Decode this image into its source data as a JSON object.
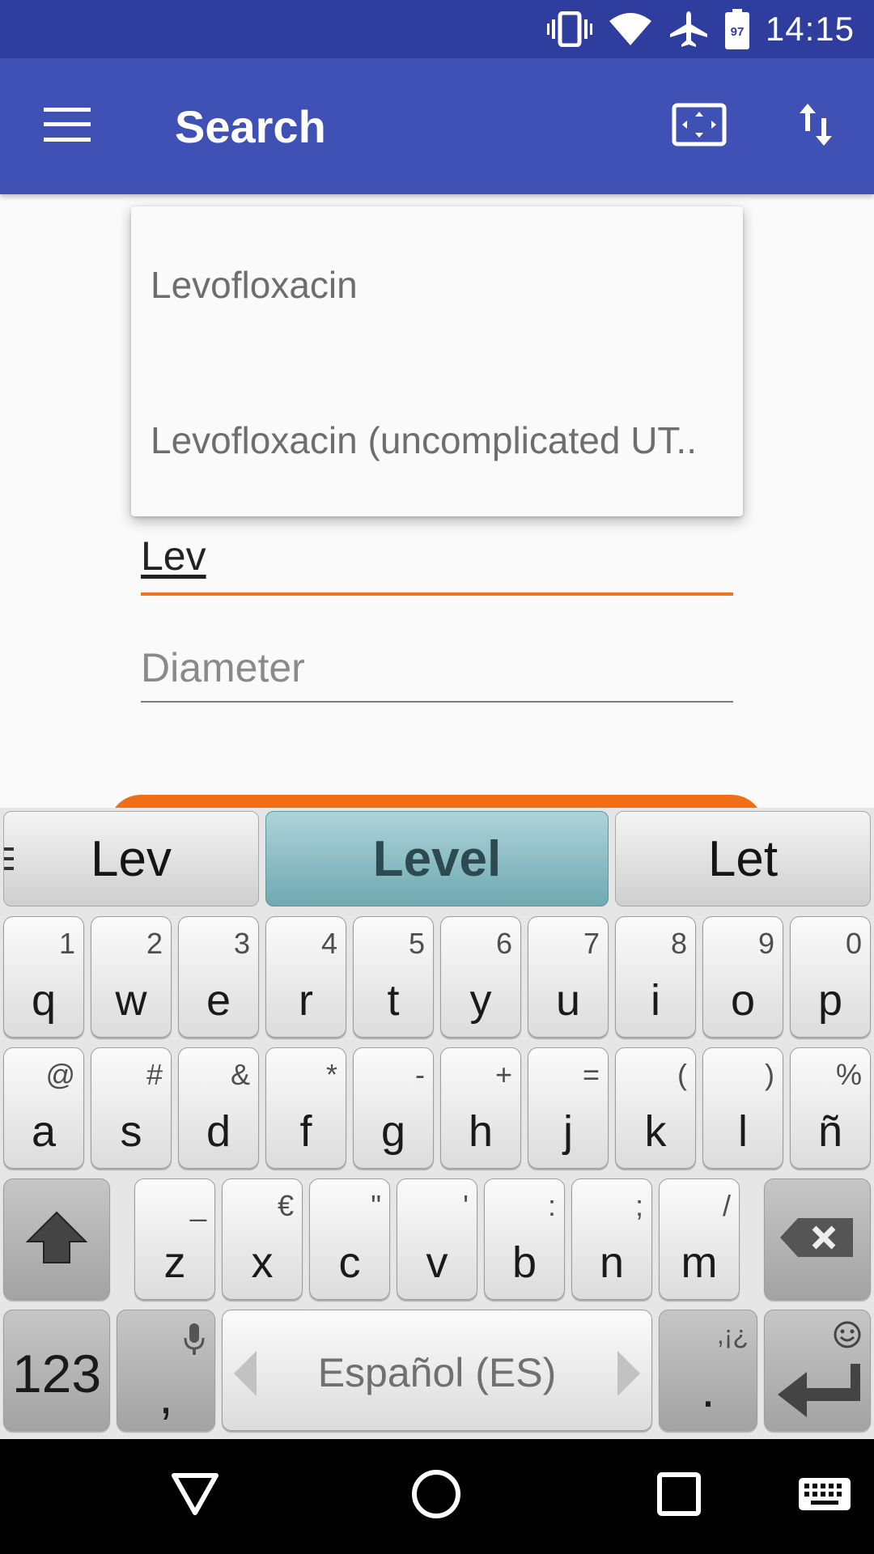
{
  "status_bar": {
    "time": "14:15",
    "battery_level": "97",
    "icons": [
      "vibrate-icon",
      "wifi-icon",
      "airplane-mode-icon",
      "battery-icon"
    ]
  },
  "app_bar": {
    "title": "Search",
    "icons": [
      "menu-icon",
      "fit-screen-icon",
      "sort-icon"
    ],
    "color": "#3f51b5"
  },
  "autocomplete": {
    "items": [
      "Levofloxacin",
      "Levofloxacin (uncomplicated UT.."
    ]
  },
  "form": {
    "query_value": "Lev",
    "diameter_placeholder": "Diameter",
    "accent_color": "#f0731f"
  },
  "keyboard": {
    "suggestions": [
      "Lev",
      "Level",
      "Let"
    ],
    "active_suggestion": "Level",
    "row1": [
      {
        "key": "q",
        "hint": "1"
      },
      {
        "key": "w",
        "hint": "2"
      },
      {
        "key": "e",
        "hint": "3"
      },
      {
        "key": "r",
        "hint": "4"
      },
      {
        "key": "t",
        "hint": "5"
      },
      {
        "key": "y",
        "hint": "6"
      },
      {
        "key": "u",
        "hint": "7"
      },
      {
        "key": "i",
        "hint": "8"
      },
      {
        "key": "o",
        "hint": "9"
      },
      {
        "key": "p",
        "hint": "0"
      }
    ],
    "row2": [
      {
        "key": "a",
        "hint": "@"
      },
      {
        "key": "s",
        "hint": "#"
      },
      {
        "key": "d",
        "hint": "&"
      },
      {
        "key": "f",
        "hint": "*"
      },
      {
        "key": "g",
        "hint": "-"
      },
      {
        "key": "h",
        "hint": "+"
      },
      {
        "key": "j",
        "hint": "="
      },
      {
        "key": "k",
        "hint": "("
      },
      {
        "key": "l",
        "hint": ")"
      },
      {
        "key": "ñ",
        "hint": "%"
      }
    ],
    "row3": [
      {
        "key": "z",
        "hint": "_"
      },
      {
        "key": "x",
        "hint": "€"
      },
      {
        "key": "c",
        "hint": "\""
      },
      {
        "key": "v",
        "hint": "'"
      },
      {
        "key": "b",
        "hint": ":"
      },
      {
        "key": "n",
        "hint": ";"
      },
      {
        "key": "m",
        "hint": "/"
      }
    ],
    "numbers_key": "123",
    "comma_key": ",",
    "space_label": "Español (ES)",
    "period_key": ".",
    "period_hint": ",¡¿"
  },
  "nav_bar": {
    "icons": [
      "back-icon",
      "home-icon",
      "recents-icon",
      "keyboard-icon"
    ]
  }
}
